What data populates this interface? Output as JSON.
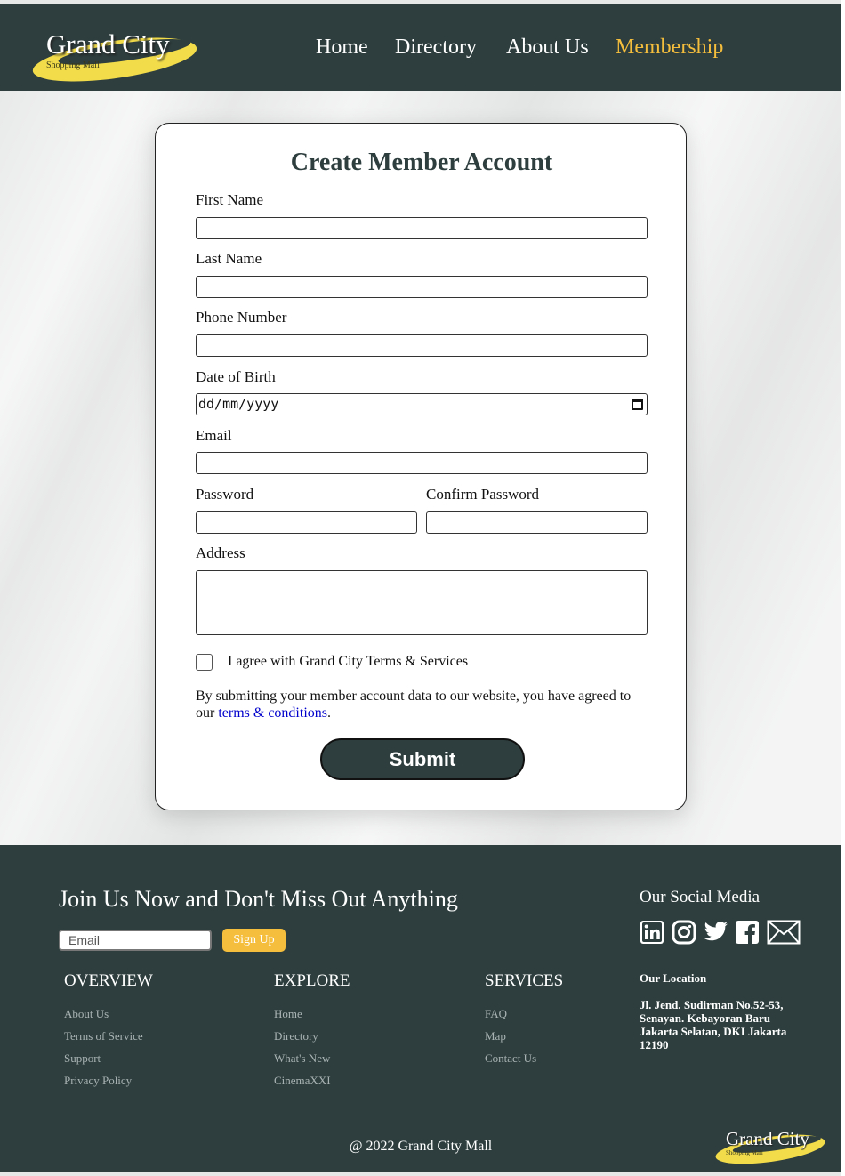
{
  "header": {
    "logo_name": "Grand City",
    "logo_sub": "Shopping Mall",
    "nav": [
      {
        "label": "Home"
      },
      {
        "label": "Directory"
      },
      {
        "label": "About Us"
      },
      {
        "label": "Membership",
        "active": true
      }
    ],
    "active_color": "#f5be3c",
    "bg_color": "#2e3e3e"
  },
  "form": {
    "title": "Create Member Account",
    "first_name_label": "First Name",
    "first_name_value": "",
    "last_name_label": "Last Name",
    "last_name_value": "",
    "phone_label": "Phone Number",
    "phone_value": "",
    "dob_label": "Date of Birth",
    "dob_placeholder": "dd/mm/yyyy",
    "email_label": "Email",
    "email_value": "",
    "password_label": "Password",
    "confirm_password_label": "Confirm Password",
    "address_label": "Address",
    "address_value": "",
    "agree_label": "I agree with Grand City Terms & Services",
    "agree_checked": false,
    "notice_text": "By submitting your member account data to our website, you have agreed to our",
    "notice_link": "terms & conditions",
    "notice_end": ".",
    "submit_label": "Submit"
  },
  "footer": {
    "join_title": "Join Us Now and Don't Miss Out Anything",
    "email_placeholder": "Email",
    "signup_label": "Sign Up",
    "signup_color": "#f5be3c",
    "overview": {
      "title": "OVERVIEW",
      "links": [
        "About Us",
        "Terms of Service",
        "Support",
        "Privacy Policy"
      ]
    },
    "explore": {
      "title": "EXPLORE",
      "links": [
        "Home",
        "Directory",
        "What's New",
        "CinemaXXI"
      ]
    },
    "services": {
      "title": "SERVICES",
      "links": [
        "FAQ",
        "Map",
        "Contact Us"
      ]
    },
    "social_title": "Our Social Media",
    "social_icons": [
      "linkedin-icon",
      "instagram-icon",
      "twitter-icon",
      "facebook-icon",
      "mail-icon"
    ],
    "location_title": "Our Location",
    "location_text": "Jl. Jend. Sudirman No.52-53, Senayan. Kebayoran Baru Jakarta Selatan, DKI Jakarta 12190",
    "copyright": "@ 2022 Grand City Mall",
    "logo_name": "Grand City",
    "logo_sub": "Shopping Mall"
  }
}
